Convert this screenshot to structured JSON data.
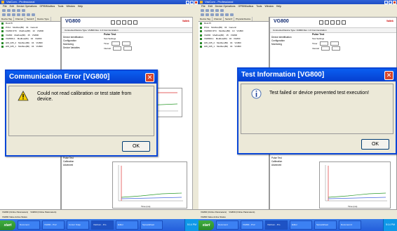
{
  "left": {
    "window_title": "VisiCom - Professional",
    "menu": [
      "File",
      "Edit",
      "Device Operations",
      "GPIB/Modbus",
      "Tools",
      "Window",
      "Help"
    ],
    "columns": [
      "Device Tag",
      "Channel",
      "Serial #",
      "Device Type"
    ],
    "tree": [
      {
        "tag": "Root Pt",
        "channel": "",
        "serial": "",
        "type": ""
      },
      {
        "tag": "PV11",
        "channel": "Modbus(80)",
        "serial": "04",
        "type": "Generic"
      },
      {
        "tag": "VG800 DTC",
        "channel": "Modbus(80)",
        "serial": "10",
        "type": "VG800"
      },
      {
        "tag": "VG800",
        "channel": "Modbus(80)",
        "serial": "15",
        "type": "VG800"
      },
      {
        "tag": "VG8000-1",
        "channel": "Modbus(80)",
        "serial": "04",
        "type": "VG800"
      },
      {
        "tag": "HW_025_2",
        "channel": "Modbus(80)",
        "serial": "04",
        "type": "VG800"
      },
      {
        "tag": "HW_025_1",
        "channel": "Modbus(80)",
        "serial": "04",
        "type": "VG800"
      }
    ],
    "device_title": "VG800",
    "brand": "Valtek",
    "info_line": "Connected    Device Type: VG800    Rev: 1.0    Communication",
    "panel_title": "Pulse Test",
    "fields": [
      "Test Settings",
      "Timer",
      "Interval"
    ],
    "nav": [
      "Device Identification",
      "Configuration",
      "Monitoring",
      "Device Variables"
    ],
    "nav_bottom": [
      "Pulse Test",
      "Calibration",
      "Advanced"
    ],
    "status_tabs": [
      "VG800 (Online Parameters)",
      "VG800 (Online Parameters)"
    ],
    "status_text": "VG800 Value Active Status",
    "chart_label": "Time (ms)",
    "dialog": {
      "title": "Communication Error [VG800]",
      "message": "Could not read calibration or test state from\ndevice.",
      "ok": "OK",
      "icon": "warning-icon"
    },
    "taskbar": {
      "start": "start",
      "tasks": [
        "Document",
        "VG800 - Prof",
        "Cursor Snap",
        "VisiCom - Pro",
        "Editor",
        "Spreadsheet"
      ],
      "clock": "5:14 PM"
    }
  },
  "right": {
    "window_title": "VisiCom - Professional",
    "menu": [
      "File",
      "Edit",
      "Device Operations",
      "GPIB/Modbus",
      "Tools",
      "Window",
      "Help"
    ],
    "columns": [
      "Device Tag",
      "Channel",
      "Serial #",
      "Physical Device"
    ],
    "tree": [
      {
        "tag": "Root Pt",
        "channel": "",
        "serial": "",
        "type": ""
      },
      {
        "tag": "PV11",
        "channel": "Modbus(80)",
        "serial": "04",
        "type": "Generic"
      },
      {
        "tag": "VG8000 DTC",
        "channel": "Modbus(80)",
        "serial": "10",
        "type": "VG800"
      },
      {
        "tag": "VG800",
        "channel": "Modbus(80)",
        "serial": "15",
        "type": "VG800"
      },
      {
        "tag": "VG8000-1",
        "channel": "Modbus(80)",
        "serial": "04",
        "type": "VG800"
      },
      {
        "tag": "HW_025_2",
        "channel": "Modbus(80)",
        "serial": "04",
        "type": "VG800"
      },
      {
        "tag": "HW_025_1",
        "channel": "Modbus(80)",
        "serial": "04",
        "type": "VG800"
      }
    ],
    "device_title": "VG800",
    "brand": "Valtek",
    "info_line": "Connected    Device Type: VG800    Rev: 1.0    Communication",
    "panel_title": "Pulse Test",
    "fields": [
      "Test Settings",
      "Timer",
      "Interval"
    ],
    "nav": [
      "Device Identification",
      "Configuration",
      "Monitoring"
    ],
    "nav_bottom": [
      "Pulse Test",
      "Calibration",
      "Advanced"
    ],
    "status_tabs": [
      "VG800 (Online Parameters)",
      "VG800 (Online Parameters)"
    ],
    "status_text": "VG800 Value Active Status",
    "chart_label": "Time (ms)",
    "dialog": {
      "title": "Test Information [VG800]",
      "message": "Test failed or device prevented test execution!",
      "ok": "OK",
      "icon": "info-icon"
    },
    "taskbar": {
      "start": "start",
      "tasks": [
        "Document",
        "VG800 - Prof",
        "VisiCom - Pro",
        "Editor",
        "Spreadsheet",
        "Document 2"
      ],
      "clock": "5:14 PM"
    }
  }
}
